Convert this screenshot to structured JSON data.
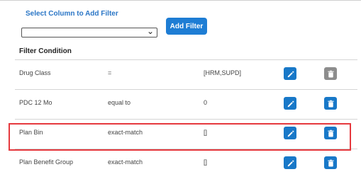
{
  "filter_controls": {
    "select_label": "Select Column to Add Filter",
    "select_value": "",
    "add_filter_label": "Add Filter"
  },
  "table": {
    "heading": "Filter Condition",
    "rows": [
      {
        "column": "Drug Class",
        "operator": "=",
        "value": "[HRM,SUPD]",
        "delete_enabled": false
      },
      {
        "column": "PDC 12 Mo",
        "operator": "equal to",
        "value": "0",
        "delete_enabled": true
      },
      {
        "column": "Plan Bin",
        "operator": "exact-match",
        "value": "[]",
        "delete_enabled": true,
        "highlighted": true
      },
      {
        "column": "Plan Benefit Group",
        "operator": "exact-match",
        "value": "[]",
        "delete_enabled": true
      }
    ]
  },
  "colors": {
    "accent": "#1e7dd4",
    "highlight": "#e5393e",
    "disabled": "#8d8d8d"
  }
}
